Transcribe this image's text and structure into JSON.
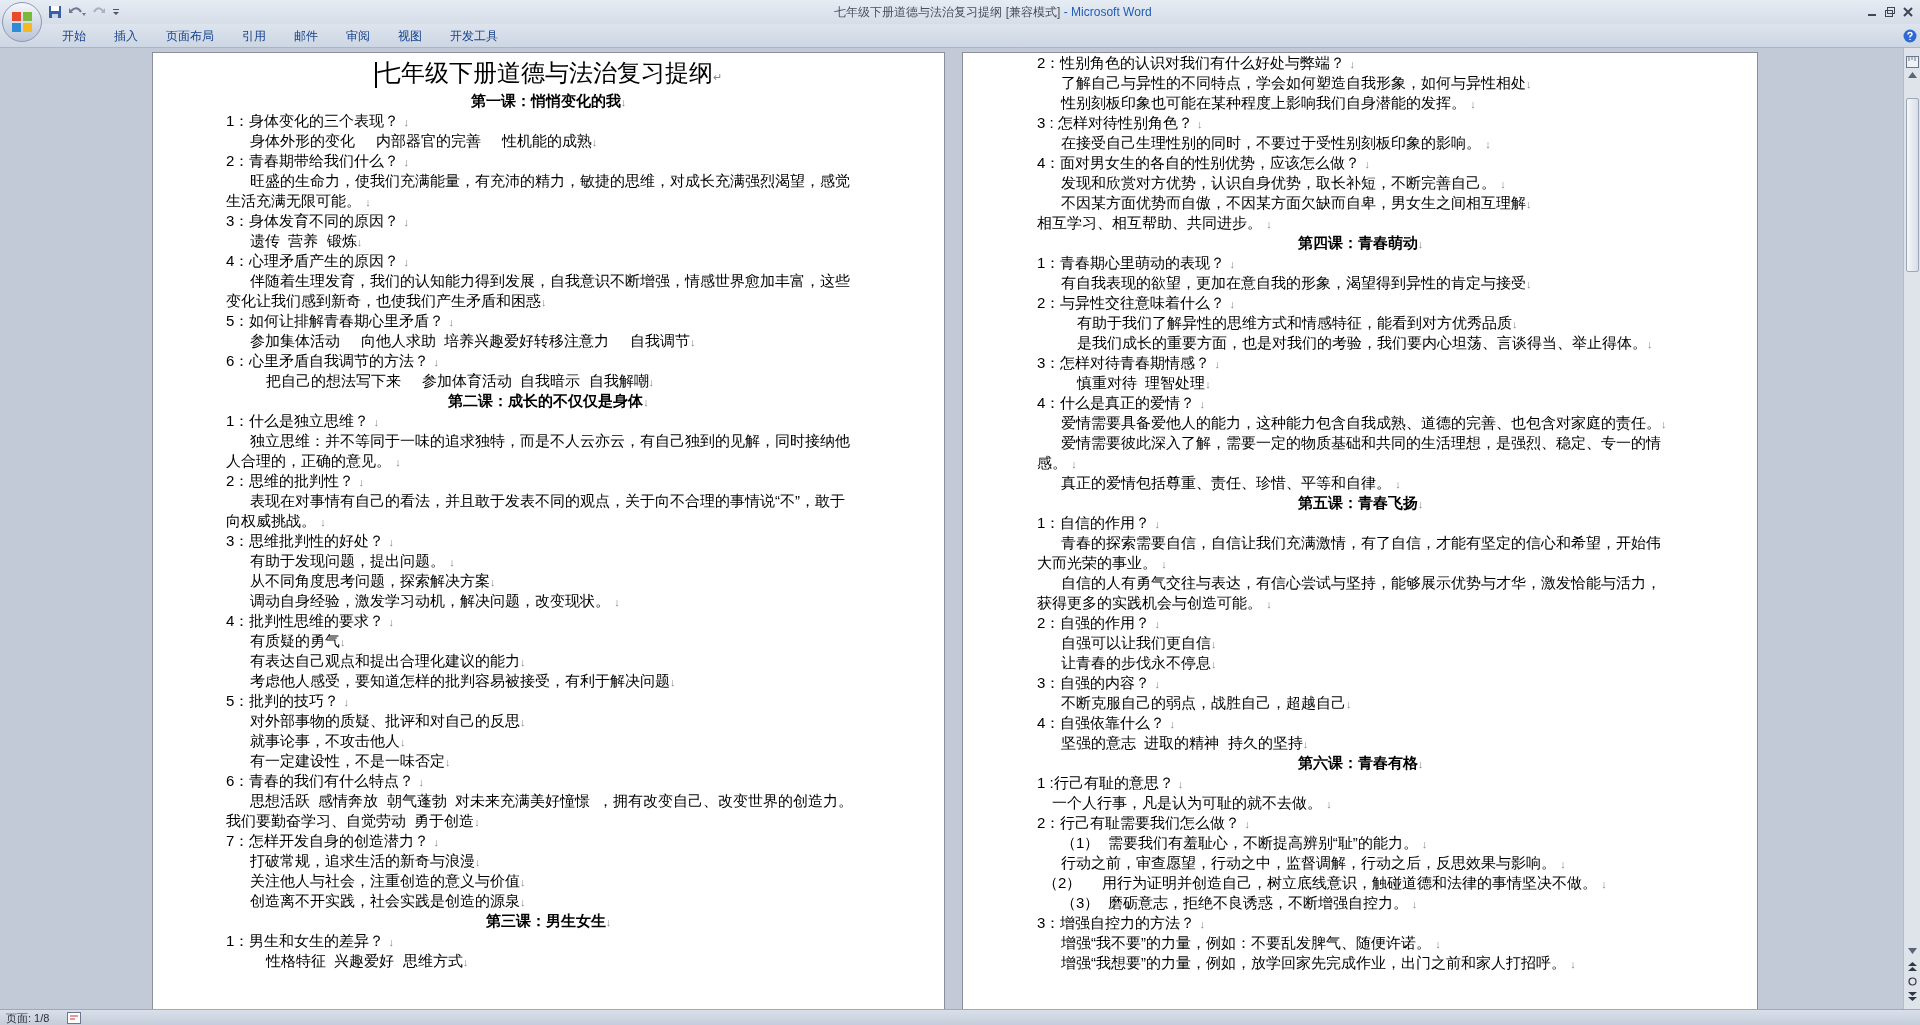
{
  "window": {
    "title": "七年级下册道德与法治复习提纲 [兼容模式]",
    "app": "- Microsoft Word"
  },
  "ribbon_tabs": [
    {
      "label": "开始",
      "selected": false
    },
    {
      "label": "插入",
      "selected": false
    },
    {
      "label": "页面布局",
      "selected": false
    },
    {
      "label": "引用",
      "selected": false
    },
    {
      "label": "邮件",
      "selected": false
    },
    {
      "label": "审阅",
      "selected": false
    },
    {
      "label": "视图",
      "selected": false
    },
    {
      "label": "开发工具",
      "selected": false
    }
  ],
  "pages": [
    {
      "lines": [
        {
          "kind": "title",
          "text": "七年级下册道德与法治复习提纲",
          "end": "↵"
        },
        {
          "kind": "heading",
          "text": "第一课：悄悄变化的我",
          "end": "↓"
        },
        {
          "kind": "question",
          "text": "1：身体变化的三个表现？ ",
          "end": "↓"
        },
        {
          "kind": "answer",
          "text": "身体外形的变化     内部器官的完善     性机能的成熟",
          "end": "↓"
        },
        {
          "kind": "question",
          "text": "2：青春期带给我们什么？ ",
          "end": "↓"
        },
        {
          "kind": "para",
          "text": "旺盛的生命力，使我们充满能量，有充沛的精力，敏捷的思维，对成长充满强烈渴望，感觉生活充满无限可能。 ",
          "end": "↓"
        },
        {
          "kind": "question",
          "text": "3：身体发育不同的原因？ ",
          "end": "↓"
        },
        {
          "kind": "answer",
          "text": "遗传  营养  锻炼",
          "end": "↓"
        },
        {
          "kind": "question",
          "text": "4：心理矛盾产生的原因？ ",
          "end": "↓"
        },
        {
          "kind": "para",
          "text": "伴随着生理发育，我们的认知能力得到发展，自我意识不断增强，情感世界愈加丰富，这些变化让我们感到新奇，也使我们产生矛盾和困惑",
          "end": "↓"
        },
        {
          "kind": "question",
          "text": "5：如何让排解青春期心里矛盾？ ",
          "end": "↓"
        },
        {
          "kind": "answer",
          "text": "参加集体活动     向他人求助  培养兴趣爱好转移注意力     自我调节",
          "end": "↓"
        },
        {
          "kind": "question",
          "text": "6：心里矛盾自我调节的方法？ ",
          "end": "↓"
        },
        {
          "kind": "deep",
          "text": "把自己的想法写下来     参加体育活动  自我暗示  自我解嘲",
          "end": "↓"
        },
        {
          "kind": "heading",
          "text": "第二课：成长的不仅仅是身体",
          "end": "↓"
        },
        {
          "kind": "question",
          "text": "1：什么是独立思维？ ",
          "end": "↓"
        },
        {
          "kind": "para",
          "text": "独立思维：并不等同于一味的追求独特，而是不人云亦云，有自己独到的见解，同时接纳他人合理的，正确的意见。 ",
          "end": "↓"
        },
        {
          "kind": "question",
          "text": "2：思维的批判性？ ",
          "end": "↓"
        },
        {
          "kind": "para",
          "text": "表现在对事情有自己的看法，并且敢于发表不同的观点，关于向不合理的事情说“不”，敢于向权威挑战。 ",
          "end": "↓"
        },
        {
          "kind": "question",
          "text": "3：思维批判性的好处？ ",
          "end": "↓"
        },
        {
          "kind": "answer",
          "text": "有助于发现问题，提出问题。 ",
          "end": "↓"
        },
        {
          "kind": "answer",
          "text": "从不同角度思考问题，探索解决方案",
          "end": "↓"
        },
        {
          "kind": "answer",
          "text": "调动自身经验，激发学习动机，解决问题，改变现状。 ",
          "end": "↓"
        },
        {
          "kind": "question",
          "text": "4：批判性思维的要求？ ",
          "end": "↓"
        },
        {
          "kind": "answer",
          "text": "有质疑的勇气",
          "end": "↓"
        },
        {
          "kind": "answer",
          "text": "有表达自己观点和提出合理化建议的能力",
          "end": "↓"
        },
        {
          "kind": "answer",
          "text": "考虑他人感受，要知道怎样的批判容易被接受，有利于解决问题",
          "end": "↓"
        },
        {
          "kind": "question",
          "text": "5：批判的技巧？ ",
          "end": "↓"
        },
        {
          "kind": "answer",
          "text": "对外部事物的质疑、批评和对自己的反思",
          "end": "↓"
        },
        {
          "kind": "answer",
          "text": "就事论事，不攻击他人",
          "end": "↓"
        },
        {
          "kind": "answer",
          "text": "有一定建设性，不是一味否定",
          "end": "↓"
        },
        {
          "kind": "question",
          "text": "6：青春的我们有什么特点？ ",
          "end": "↓"
        },
        {
          "kind": "para",
          "text": "思想活跃  感情奔放  朝气蓬勃  对未来充满美好憧憬  ，拥有改变自己、改变世界的创造力。我们要勤奋学习、自觉劳动  勇于创造",
          "end": "↓"
        },
        {
          "kind": "question",
          "text": "7：怎样开发自身的创造潜力？ ",
          "end": "↓"
        },
        {
          "kind": "answer",
          "text": "打破常规，追求生活的新奇与浪漫",
          "end": "↓"
        },
        {
          "kind": "answer",
          "text": "关注他人与社会，注重创造的意义与价值",
          "end": "↓"
        },
        {
          "kind": "answer",
          "text": "创造离不开实践，社会实践是创造的源泉",
          "end": "↓"
        },
        {
          "kind": "heading",
          "text": "第三课：男生女生",
          "end": "↓"
        },
        {
          "kind": "question",
          "text": "1：男生和女生的差异？ ",
          "end": "↓"
        },
        {
          "kind": "deep",
          "text": "性格特征  兴趣爱好  思维方式",
          "end": "↓"
        }
      ]
    },
    {
      "lines": [
        {
          "kind": "question",
          "text": "2：性别角色的认识对我们有什么好处与弊端？ ",
          "end": "↓"
        },
        {
          "kind": "answer",
          "text": "了解自己与异性的不同特点，学会如何塑造自我形象，如何与异性相处",
          "end": "↓"
        },
        {
          "kind": "answer",
          "text": "性别刻板印象也可能在某种程度上影响我们自身潜能的发挥。 ",
          "end": "↓"
        },
        {
          "kind": "question",
          "text": "3 : 怎样对待性别角色？ ",
          "end": "↓"
        },
        {
          "kind": "answer",
          "text": "在接受自己生理性别的同时，不要过于受性别刻板印象的影响。 ",
          "end": "↓"
        },
        {
          "kind": "question",
          "text": "4：面对男女生的各自的性别优势，应该怎么做？ ",
          "end": "↓"
        },
        {
          "kind": "answer",
          "text": "发现和欣赏对方优势，认识自身优势，取长补短，不断完善自己。 ",
          "end": "↓"
        },
        {
          "kind": "answer",
          "text": "不因某方面优势而自傲，不因某方面欠缺而自卑，男女生之间相互理解",
          "end": "↓"
        },
        {
          "kind": "flush",
          "text": "相互学习、相互帮助、共同进步。 ",
          "end": "↓"
        },
        {
          "kind": "heading",
          "text": "第四课：青春萌动",
          "end": "↓"
        },
        {
          "kind": "question",
          "text": "1：青春期心里萌动的表现？ ",
          "end": "↓"
        },
        {
          "kind": "answer",
          "text": "有自我表现的欲望，更加在意自我的形象，渴望得到异性的肯定与接受",
          "end": "↓"
        },
        {
          "kind": "question",
          "text": "2：与异性交往意味着什么？ ",
          "end": "↓"
        },
        {
          "kind": "deep",
          "text": "有助于我们了解异性的思维方式和情感特征，能看到对方优秀品质",
          "end": "↓"
        },
        {
          "kind": "deep",
          "text": "是我们成长的重要方面，也是对我们的考验，我们要内心坦荡、言谈得当、举止得体。",
          "end": "↓"
        },
        {
          "kind": "question",
          "text": "3：怎样对待青春期情感？ ",
          "end": "↓"
        },
        {
          "kind": "deep",
          "text": "慎重对待  理智处理",
          "end": "↓"
        },
        {
          "kind": "question",
          "text": "4：什么是真正的爱情？ ",
          "end": "↓"
        },
        {
          "kind": "answer",
          "text": "爱情需要具备爱他人的能力，这种能力包含自我成熟、道德的完善、也包含对家庭的责任。",
          "end": "↓"
        },
        {
          "kind": "para",
          "text": "爱情需要彼此深入了解，需要一定的物质基础和共同的生活理想，是强烈、稳定、专一的情感。 ",
          "end": "↓"
        },
        {
          "kind": "answer",
          "text": "真正的爱情包括尊重、责任、珍惜、平等和自律。 ",
          "end": "↓"
        },
        {
          "kind": "heading",
          "text": "第五课：青春飞扬",
          "end": "↓"
        },
        {
          "kind": "question",
          "text": "1：自信的作用？ ",
          "end": "↓"
        },
        {
          "kind": "para",
          "text": "青春的探索需要自信，自信让我们充满激情，有了自信，才能有坚定的信心和希望，开始伟大而光荣的事业。 ",
          "end": "↓"
        },
        {
          "kind": "para",
          "text": "自信的人有勇气交往与表达，有信心尝试与坚持，能够展示优势与才华，激发恰能与活力，获得更多的实践机会与创造可能。 ",
          "end": "↓"
        },
        {
          "kind": "question",
          "text": "2：自强的作用？ ",
          "end": "↓"
        },
        {
          "kind": "answer",
          "text": "自强可以让我们更自信",
          "end": "↓"
        },
        {
          "kind": "answer",
          "text": "让青春的步伐永不停息",
          "end": "↓"
        },
        {
          "kind": "question",
          "text": "3：自强的内容？ ",
          "end": "↓"
        },
        {
          "kind": "answer",
          "text": "不断克服自己的弱点，战胜自己，超越自己",
          "end": "↓"
        },
        {
          "kind": "question",
          "text": "4：自强依靠什么？ ",
          "end": "↓"
        },
        {
          "kind": "answer",
          "text": "坚强的意志  进取的精神  持久的坚持",
          "end": "↓"
        },
        {
          "kind": "heading",
          "text": "第六课：青春有格",
          "end": "↓"
        },
        {
          "kind": "question",
          "text": "1 :行己有耻的意思？ ",
          "end": "↓"
        },
        {
          "kind": "slight",
          "text": "一个人行事，凡是认为可耻的就不去做。 ",
          "end": "↓"
        },
        {
          "kind": "question",
          "text": "2：行己有耻需要我们怎么做？ ",
          "end": "↓"
        },
        {
          "kind": "answer",
          "text": "（1）  需要我们有羞耻心，不断提高辨别“耻”的能力。 ",
          "end": "↓"
        },
        {
          "kind": "answer",
          "text": "行动之前，审查愿望，行动之中，监督调解，行动之后，反思效果与影响。 ",
          "end": "↓"
        },
        {
          "kind": "tiny",
          "text": "（2）     用行为证明并创造自己，树立底线意识，触碰道德和法律的事情坚决不做。 ",
          "end": "↓"
        },
        {
          "kind": "answer",
          "text": "（3）  磨砺意志，拒绝不良诱惑，不断增强自控力。 ",
          "end": "↓"
        },
        {
          "kind": "question",
          "text": "3：增强自控力的方法？ ",
          "end": "↓"
        },
        {
          "kind": "answer",
          "text": "增强“我不要”的力量，例如：不要乱发脾气、随便许诺。 ",
          "end": "↓"
        },
        {
          "kind": "answer",
          "text": "增强“我想要”的力量，例如，放学回家先完成作业，出门之前和家人打招呼。 ",
          "end": "↓"
        }
      ]
    }
  ],
  "status_bar": {
    "page": "页面: 1/8"
  }
}
